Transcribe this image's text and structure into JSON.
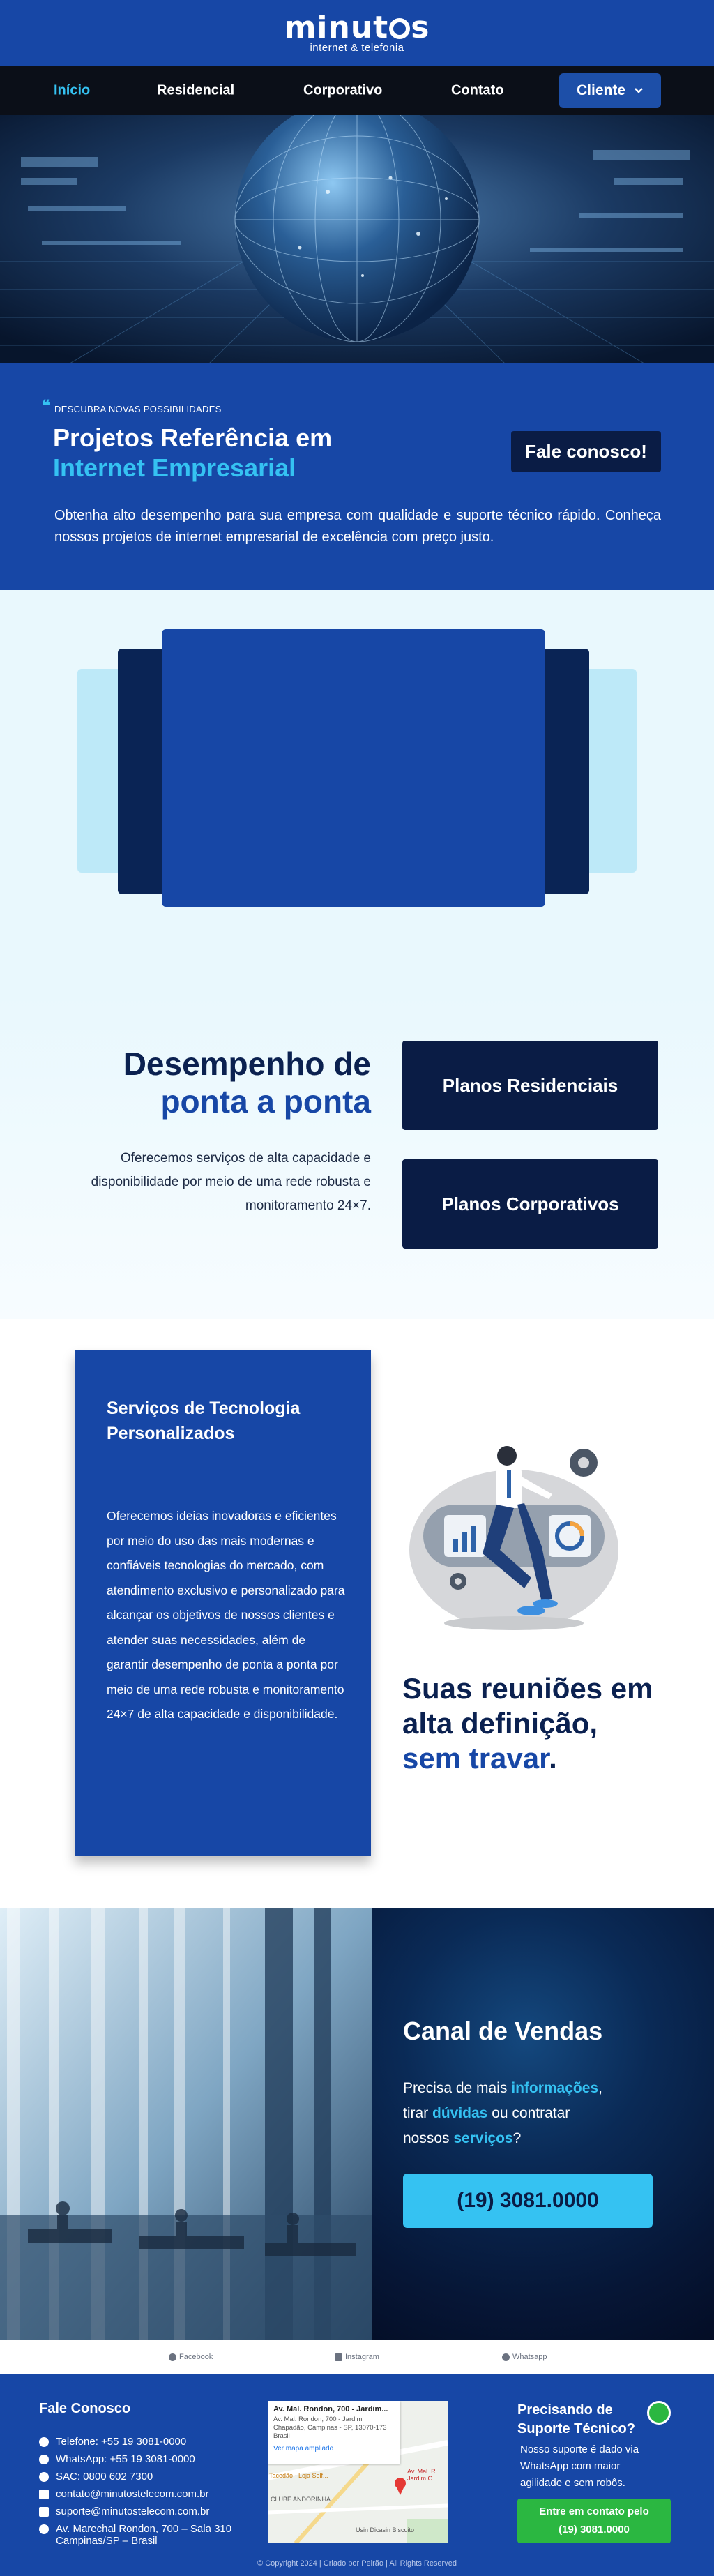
{
  "logo": {
    "brand_pre": "minut",
    "brand_post": "s",
    "tagline": "internet & telefonia"
  },
  "nav": {
    "items": [
      "Início",
      "Residencial",
      "Corporativo",
      "Contato"
    ],
    "client_label": "Cliente"
  },
  "intro": {
    "kicker": "DESCUBRA NOVAS POSSIBILIDADES",
    "title_line1": "Projetos Referência em",
    "title_line2": "Internet Empresarial",
    "cta": "Fale conosco!",
    "text": "Obtenha alto desempenho para sua empresa com qualidade e suporte técnico rápido. Conheça nossos projetos de internet empresarial de excelência com preço justo."
  },
  "performance": {
    "title_line1": "Desempenho de",
    "title_line2": "ponta a ponta",
    "text": "Oferecemos serviços de alta capacidade e disponibilidade por meio de uma rede robusta e monitoramento 24×7.",
    "btn_residential": "Planos Residenciais",
    "btn_corporate": "Planos Corporativos"
  },
  "services": {
    "title": "Serviços de Tecnologia Personalizados",
    "text": "Oferecemos ideias inovadoras e eficientes por meio do uso das mais modernas e confiáveis tecnologias do mercado, com atendimento exclusivo e personalizado para alcançar os objetivos de nossos clientes e atender suas necessidades, além de garantir desempenho de ponta a ponta por meio de uma rede robusta e monitoramento 24×7 de alta capacidade e disponibilidade.",
    "headline_1": "Suas reuniões em",
    "headline_2": "alta definição,",
    "headline_3": "sem travar",
    "headline_dot": "."
  },
  "sales": {
    "title": "Canal de Vendas",
    "line1_pre": "Precisa de mais ",
    "line1_hl": "informações",
    "line1_post": ",",
    "line2_pre": "tirar ",
    "line2_hl": "dúvidas",
    "line2_post": " ou contratar",
    "line3_pre": "nossos ",
    "line3_hl": "serviços",
    "line3_post": "?",
    "phone": "(19) 3081.0000"
  },
  "social": {
    "facebook": "Facebook",
    "instagram": "Instagram",
    "whatsapp": "Whatsapp"
  },
  "footer": {
    "contact_title": "Fale Conosco",
    "phone": "Telefone: +55 19 3081-0000",
    "whatsapp": "WhatsApp: +55 19 3081-0000",
    "sac": "SAC: 0800 602 7300",
    "email_contact": "contato@minutostelecom.com.br",
    "email_support": "suporte@minutostelecom.com.br",
    "address": "Av. Marechal Rondon, 700 – Sala 310 Campinas/SP – Brasil",
    "map_title": "Av. Mal. Rondon, 700 - Jardim...",
    "map_address": "Av. Mal. Rondon, 700 - Jardim Chapadão, Campinas - SP, 13070-173 Brasil",
    "map_link": "Ver mapa ampliado",
    "map_label1": "Av. Mal. R... Jardim C...",
    "map_label2": "Tacedão - Loja Self...",
    "map_label3": "CLUBE ANDORINHA",
    "map_label4": "Usin Dicasin Biscoito",
    "support_title": "Precisando de Suporte Técnico?",
    "support_text": "Nosso suporte é dado via WhatsApp com maior agilidade e sem robôs.",
    "support_btn_1": "Entre em contato pelo",
    "support_btn_2": "(19) 3081.0000",
    "copyright": "© Copyright 2024 | Criado por Peirão | All Rights Reserved"
  },
  "colors": {
    "primary": "#1747a6",
    "navy": "#0a1c45",
    "accent": "#35c2f2",
    "whatsapp": "#2bb741"
  }
}
